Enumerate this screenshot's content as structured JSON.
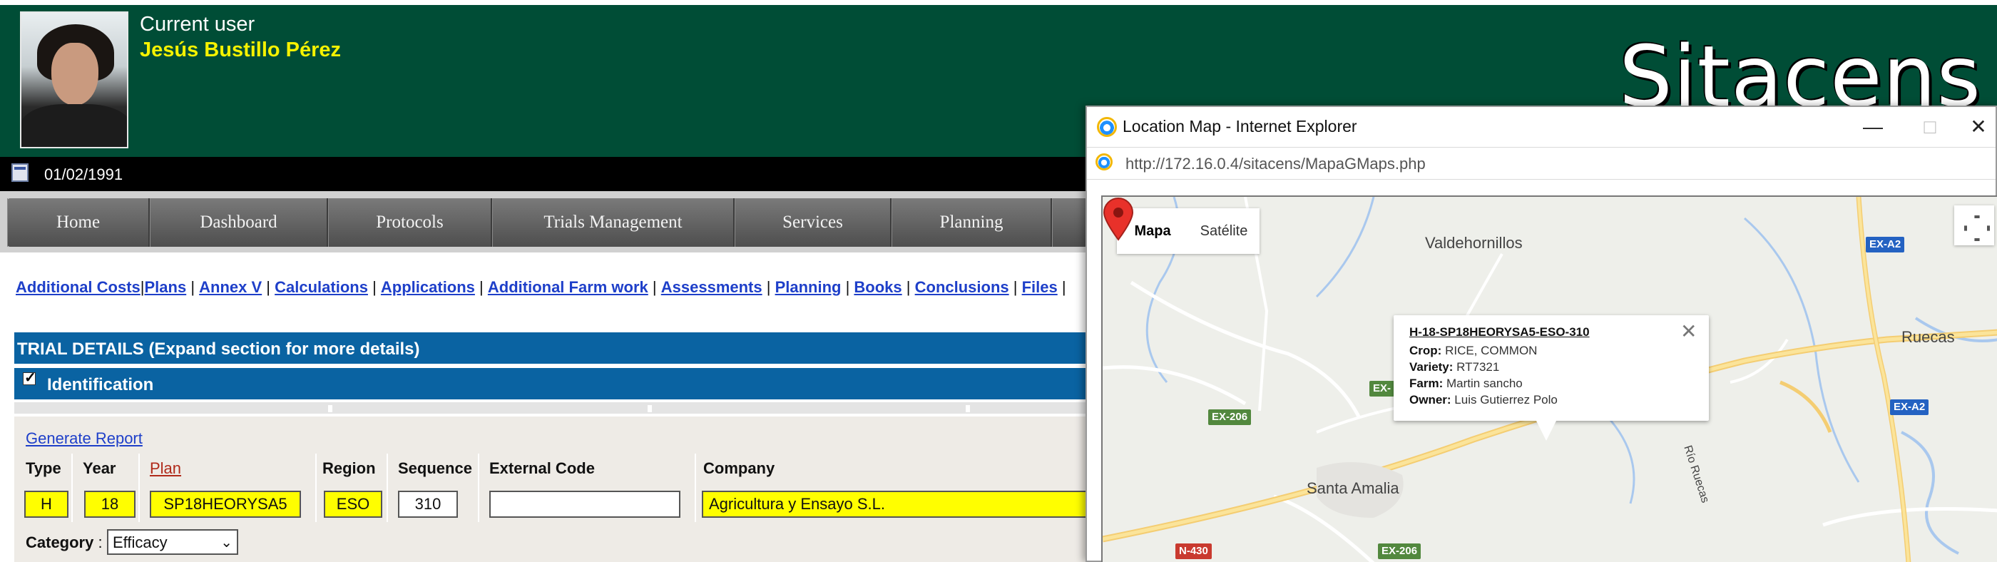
{
  "header": {
    "user_label": "Current user",
    "user_name": "Jesús Bustillo Pérez",
    "brand": "Sitacens",
    "date": "01/02/1991",
    "colors": {
      "header_bg": "#004d36",
      "user_name": "#f6f200",
      "section_bar": "#0a63a2",
      "highlight_field": "#fffe00"
    }
  },
  "nav": {
    "items": [
      "Home",
      "Dashboard",
      "Protocols",
      "Trials Management",
      "Services",
      "Planning"
    ]
  },
  "links": {
    "additional_costs": "Additional Costs",
    "plans": "Plans",
    "annex": "Annex V",
    "calculations": "Calculations",
    "applications": "Applications",
    "farm_work": "Additional Farm work",
    "assessments": "Assessments",
    "planning": "Planning",
    "books": "Books",
    "conclusions": "Conclusions",
    "files": "Files"
  },
  "trial": {
    "details_title": "TRIAL DETAILS (Expand section for more details)",
    "identification_title": "Identification",
    "generate_report": "Generate Report",
    "columns": {
      "type": "Type",
      "year": "Year",
      "plan": "Plan",
      "region": "Region",
      "sequence": "Sequence",
      "external_code": "External Code",
      "company": "Company"
    },
    "values": {
      "type": "H",
      "year": "18",
      "plan": "SP18HEORYSA5",
      "region": "ESO",
      "sequence": "310",
      "external_code": "",
      "company": "Agricultura y Ensayo S.L."
    },
    "category_label": "Category",
    "category_sep": " :",
    "category_value": "Efficacy"
  },
  "popup": {
    "title": "Location Map - Internet Explorer",
    "url": "http://172.16.0.4/sitacens/MapaGMaps.php",
    "buttons": {
      "minimize": "—",
      "maximize": "□",
      "close": "✕"
    },
    "map": {
      "type_buttons": [
        "Mapa",
        "Satélite"
      ],
      "places": [
        "Valdehornillos",
        "Ruecas",
        "Santa Amalia"
      ],
      "road_labels": [
        "EX-A2",
        "EX-A2",
        "EX-206",
        "EX-206",
        "N-430",
        "EX-",
        "Río Ruecas"
      ],
      "info": {
        "title": "H-18-SP18HEORYSA5-ESO-310",
        "crop_label": "Crop:",
        "crop": "RICE, COMMON",
        "variety_label": "Variety:",
        "variety": "RT7321",
        "farm_label": "Farm:",
        "farm": "Martin sancho",
        "owner_label": "Owner:",
        "owner": "Luis Gutierrez Polo",
        "close": "✕"
      },
      "marker_icon": "map-pin-icon"
    }
  }
}
